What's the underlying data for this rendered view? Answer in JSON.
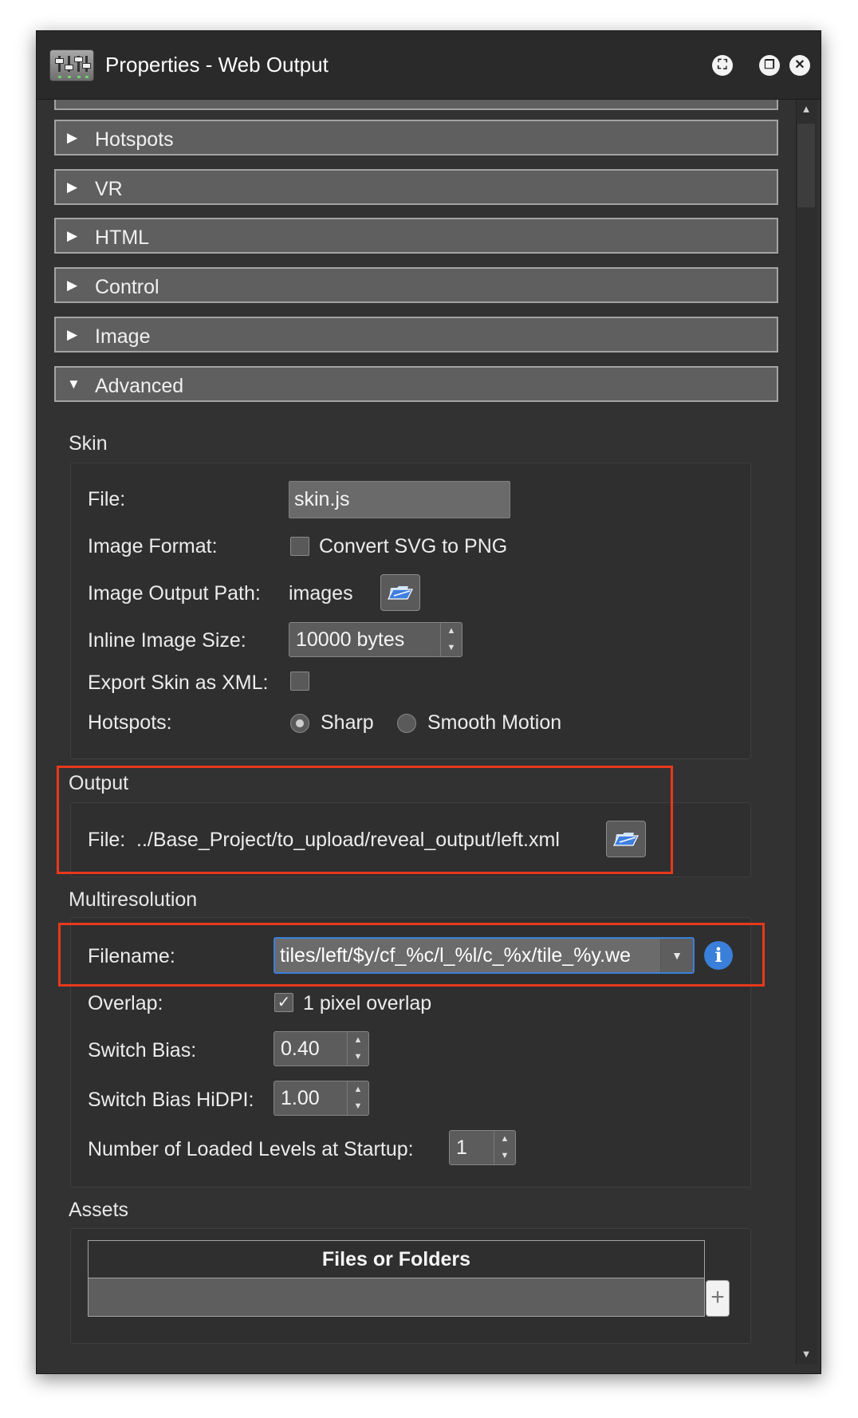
{
  "window": {
    "title": "Properties - Web Output"
  },
  "title_buttons": {
    "maximize_glyph": "⛶",
    "restore_glyph": "❐",
    "close_glyph": "✕"
  },
  "sections": {
    "hotspots": "Hotspots",
    "vr": "VR",
    "html": "HTML",
    "control": "Control",
    "image": "Image",
    "advanced": "Advanced"
  },
  "glyphs": {
    "collapsed": "▶",
    "expanded": "▼",
    "up": "▲",
    "down": "▼",
    "check": "✓",
    "plus": "+",
    "info": "i"
  },
  "skin": {
    "title": "Skin",
    "file_label": "File:",
    "file_value": "skin.js",
    "image_format_label": "Image Format:",
    "convert_svg_label": "Convert SVG to PNG",
    "convert_svg_checked": false,
    "image_output_path_label": "Image Output Path:",
    "image_output_path_value": "images",
    "inline_image_size_label": "Inline Image Size:",
    "inline_image_size_value": "10000 bytes",
    "export_xml_label": "Export Skin as XML:",
    "export_xml_checked": false,
    "hotspots_label": "Hotspots:",
    "hotspots_options": [
      "Sharp",
      "Smooth Motion"
    ],
    "hotspots_selected": "Sharp"
  },
  "output": {
    "title": "Output",
    "file_label": "File:",
    "file_value": "../Base_Project/to_upload/reveal_output/left.xml"
  },
  "multires": {
    "title": "Multiresolution",
    "filename_label": "Filename:",
    "filename_value": "tiles/left/$y/cf_%c/l_%l/c_%x/tile_%y.we",
    "overlap_label": "Overlap:",
    "overlap_option": "1 pixel overlap",
    "overlap_checked": true,
    "switch_bias_label": "Switch Bias:",
    "switch_bias_value": "0.40",
    "switch_bias_hidpi_label": "Switch Bias HiDPI:",
    "switch_bias_hidpi_value": "1.00",
    "loaded_levels_label": "Number of Loaded Levels at Startup:",
    "loaded_levels_value": "1"
  },
  "assets": {
    "title": "Assets",
    "column_header": "Files or Folders",
    "rows": []
  },
  "colors": {
    "highlight": "#e8381c",
    "accent": "#3a7fd9",
    "panel": "#323232",
    "header": "#5f5f5f"
  }
}
